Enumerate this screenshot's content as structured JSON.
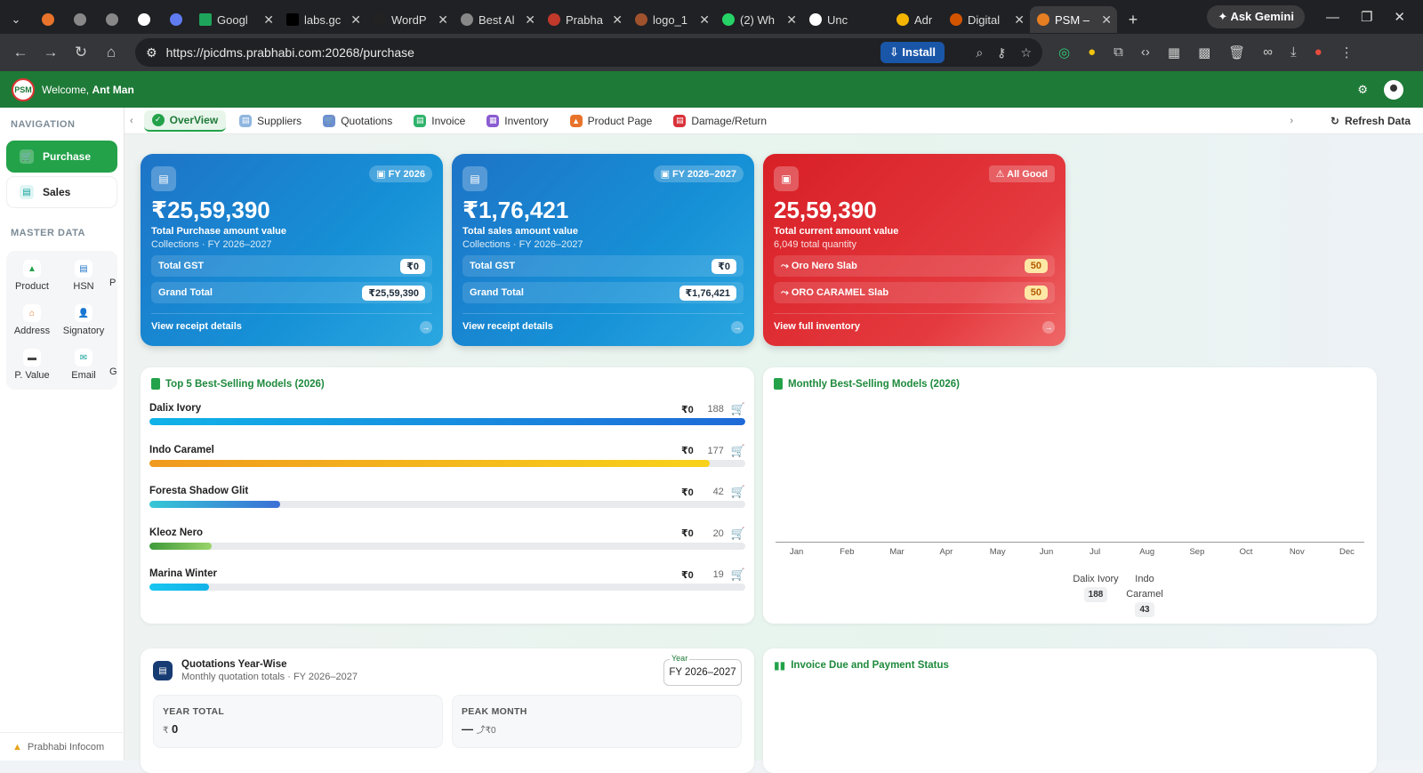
{
  "browser": {
    "tabs": [
      {
        "label": ""
      },
      {
        "label": ""
      },
      {
        "label": ""
      },
      {
        "label": ""
      },
      {
        "label": ""
      },
      {
        "label": "Googl"
      },
      {
        "label": "labs.gc"
      },
      {
        "label": "WordP"
      },
      {
        "label": "Best Al"
      },
      {
        "label": "Prabha"
      },
      {
        "label": "logo_1"
      },
      {
        "label": "(2) Wh"
      },
      {
        "label": "Unc"
      },
      {
        "label": "Adr"
      },
      {
        "label": "Digital"
      },
      {
        "label": "PSM –"
      }
    ],
    "ask_gemini": "Ask Gemini",
    "url": "https://picdms.prabhabi.com:20268/purchase",
    "install": "Install"
  },
  "header": {
    "logo_text": "PSM",
    "welcome_prefix": "Welcome,",
    "user_name": "Ant Man"
  },
  "sidebar": {
    "navigation_title": "NAVIGATION",
    "nav_items": [
      {
        "label": "Purchase",
        "active": true
      },
      {
        "label": "Sales",
        "active": false
      }
    ],
    "master_title": "MASTER DATA",
    "master_items": [
      {
        "label": "Product",
        "icon": "product-icon"
      },
      {
        "label": "HSN",
        "icon": "hsn-icon"
      },
      {
        "label": "Address",
        "icon": "home-icon"
      },
      {
        "label": "Signatory",
        "icon": "user-icon"
      },
      {
        "label": "P. Value",
        "icon": "folder-icon"
      },
      {
        "label": "Email",
        "icon": "mail-icon"
      }
    ],
    "master_cut": [
      "P",
      "G"
    ],
    "footer": "Prabhabi Infocom"
  },
  "tabs": {
    "items": [
      {
        "label": "OverView",
        "color": "#23a24a"
      },
      {
        "label": "Suppliers",
        "color": "#7aa6d6"
      },
      {
        "label": "Quotations",
        "color": "#6b8fd1"
      },
      {
        "label": "Invoice",
        "color": "#2fb36b"
      },
      {
        "label": "Inventory",
        "color": "#8a5cd1"
      },
      {
        "label": "Product Page",
        "color": "#e8732a"
      },
      {
        "label": "Damage/Return",
        "color": "#d8323a"
      }
    ],
    "refresh": "Refresh Data"
  },
  "cards": [
    {
      "badge": "FY 2026",
      "amount": "₹25,59,390",
      "label": "Total Purchase amount value",
      "sub": "Collections · FY 2026–2027",
      "rows": [
        {
          "label": "Total GST",
          "value": "₹0"
        },
        {
          "label": "Grand Total",
          "value": "₹25,59,390"
        }
      ],
      "link": "View receipt details"
    },
    {
      "badge": "FY 2026–2027",
      "amount": "₹1,76,421",
      "label": "Total sales amount value",
      "sub": "Collections · FY 2026–2027",
      "rows": [
        {
          "label": "Total GST",
          "value": "₹0"
        },
        {
          "label": "Grand Total",
          "value": "₹1,76,421"
        }
      ],
      "link": "View receipt details"
    },
    {
      "badge": "All Good",
      "amount": "25,59,390",
      "label": "Total current amount value",
      "sub": "6,049 total quantity",
      "rows": [
        {
          "label": "Oro Nero Slab",
          "value": "50"
        },
        {
          "label": "ORO CARAMEL Slab",
          "value": "50"
        }
      ],
      "link": "View full inventory"
    }
  ],
  "top5": {
    "title": "Top 5 Best-Selling Models (2026)",
    "items": [
      {
        "name": "Dalix Ivory",
        "price": "₹0",
        "qty": "188",
        "pct": 100,
        "color": "linear-gradient(90deg,#10b3e8,#1e6ad8)"
      },
      {
        "name": "Indo Caramel",
        "price": "₹0",
        "qty": "177",
        "pct": 94,
        "color": "linear-gradient(90deg,#f09a1e,#f8d21a)"
      },
      {
        "name": "Foresta Shadow Glit",
        "price": "₹0",
        "qty": "42",
        "pct": 22,
        "color": "linear-gradient(90deg,#36c7d6,#3b6fd6)"
      },
      {
        "name": "Kleoz Nero",
        "price": "₹0",
        "qty": "20",
        "pct": 10.5,
        "color": "linear-gradient(90deg,#3f9a3a,#9bd46a)"
      },
      {
        "name": "Marina Winter",
        "price": "₹0",
        "qty": "19",
        "pct": 10,
        "color": "linear-gradient(90deg,#18c6f0,#12b2e8)"
      }
    ]
  },
  "monthly": {
    "title": "Monthly Best-Selling Models (2026)",
    "months": [
      "Jan",
      "Feb",
      "Mar",
      "Apr",
      "May",
      "Jun",
      "Jul",
      "Aug",
      "Sep",
      "Oct",
      "Nov",
      "Dec"
    ],
    "legend": [
      {
        "name": "Dalix Ivory",
        "value": "188"
      },
      {
        "name_line1": "Indo",
        "name_line2": "Caramel",
        "value": "43"
      }
    ]
  },
  "quotations": {
    "title": "Quotations Year-Wise",
    "sub": "Monthly quotation totals · FY 2026–2027",
    "year_label": "Year",
    "year_value": "FY 2026–2027",
    "year_total_label": "YEAR TOTAL",
    "year_total_currency": "₹",
    "year_total_value": "0",
    "peak_label": "PEAK MONTH",
    "peak_value": "—",
    "peak_amount": "₹0"
  },
  "invoice_status": {
    "title": "Invoice Due and Payment Status"
  }
}
